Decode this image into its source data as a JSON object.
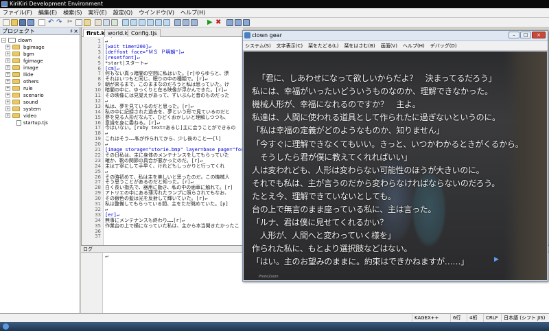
{
  "ide": {
    "title": "KiriKiri Development Environment",
    "menu": [
      "ファイル(F)",
      "編集(E)",
      "検索(S)",
      "実行(E)",
      "設定(Q)",
      "ウインドウ(V)",
      "ヘルプ(H)"
    ]
  },
  "project": {
    "header": "プロジェクト",
    "pin": "♯",
    "close": "×",
    "root": "clown",
    "folders": [
      "bgimage",
      "bgm",
      "fgimage",
      "image",
      "llide",
      "others",
      "rule",
      "scenario",
      "sound",
      "system",
      "video"
    ],
    "files": [
      "startup.tjs"
    ]
  },
  "editor": {
    "tabs": [
      "first.ks",
      "world.ks",
      "Config.tjs"
    ],
    "line_numbers": [
      "1",
      "2",
      "3",
      "4",
      "5",
      "6",
      "7",
      "8",
      "9",
      "10",
      "11",
      "12",
      "13",
      "14",
      "15",
      "16",
      "17",
      "18",
      "19",
      "20",
      "21",
      "22",
      "23",
      "24",
      "25",
      "26",
      "27",
      "28",
      "29",
      "30",
      "31",
      "32",
      "33",
      "34",
      "35",
      "36",
      "37"
    ],
    "lines": [
      {
        "t": "↵",
        "c": "c-dark"
      },
      {
        "t": "[wait time=200]↵",
        "c": "c-blue"
      },
      {
        "t": "[deffont face=\"ＭＳ Ｐ明朝\"]↵",
        "c": "c-blue"
      },
      {
        "t": "[resetfont]↵",
        "c": "c-blue"
      },
      {
        "t": "*start|スタート↵",
        "c": "c-dark"
      },
      {
        "t": "[cm]↵",
        "c": "c-blue"
      },
      {
        "t": "何もない真っ暗闇の空間に私はいた。[r]ゆらゆらと、漂",
        "c": "c-dark"
      },
      {
        "t": "それはいつもと同じ、眠りの中の種類で。[r]↵",
        "c": "c-dark"
      },
      {
        "t": "朝が来るまで、このままなのだろうと私は思っていた。け",
        "c": "c-dark"
      },
      {
        "t": "暗闇の中に、ゆっくりと在る映像が浮かんできた。[r]↵",
        "c": "c-dark"
      },
      {
        "t": "その映像には見覚えがあって、ずいぶんと昔のものだった",
        "c": "c-dark"
      },
      {
        "t": "↵",
        "c": "c-dark"
      },
      {
        "t": "私は、夢を見ているのだと思った。[r]↵",
        "c": "c-dark"
      },
      {
        "t": "私の中に記録された過去を、夢という形で見ているのだと",
        "c": "c-dark"
      },
      {
        "t": "夢を見る人形だなんて、ひどくおかしいと理解しつつも、",
        "c": "c-dark"
      },
      {
        "t": "意識を身に委ねる。[r]↵",
        "c": "c-dark"
      },
      {
        "t": "今はいない。[ruby text=あるじ]主に会うことができるの",
        "c": "c-dark"
      },
      {
        "t": "↵",
        "c": "c-dark"
      },
      {
        "t": "これはそう……私が作られてから、少し後のこと──[l]",
        "c": "c-dark"
      },
      {
        "t": "↵",
        "c": "c-dark"
      },
      {
        "t": "[image storage=\"storie.bmp\" layer=base page=\"fore\"]",
        "c": "c-blue"
      },
      {
        "t": "その日私は、主に身体のメンテナンスをしてもらっていた",
        "c": "c-dark"
      },
      {
        "t": "確か、靴の関節の具合が悪かったのだ。[r]↵",
        "c": "c-dark"
      },
      {
        "t": "主は丁寧にして手早く、けれどもしっかりと行ってくれ",
        "c": "c-dark"
      },
      {
        "t": "↵",
        "c": "c-dark"
      },
      {
        "t": "その時初めて、私は主を美しいと思ったのだ。この機械人",
        "c": "c-dark"
      },
      {
        "t": "そう思うことがあるのだと知った。[r]↵",
        "c": "c-dark"
      },
      {
        "t": "白く長い指先で、器用に動き、私の中の歯車に触れて。[r]",
        "c": "c-dark"
      },
      {
        "t": "アトリエの中にある薄汚れたランプに照らされてもなお、",
        "c": "c-dark"
      },
      {
        "t": "その銀色の髪は光を反射して輝いていた。[r]↵",
        "c": "c-dark"
      },
      {
        "t": "私は整備してもらっている間、主をただ眺めていた。[p]",
        "c": "c-dark"
      },
      {
        "t": "↵",
        "c": "c-dark"
      },
      {
        "t": "[er]↵",
        "c": "c-blue"
      },
      {
        "t": "無事にメンテナンスも終わり……[r]↵",
        "c": "c-dark"
      },
      {
        "t": "作業台の上で横になっていた私は、主から本当聞きたかったこ",
        "c": "c-dark"
      }
    ]
  },
  "log": {
    "label": "ログ",
    "content": "↵"
  },
  "status": {
    "mode": "KAGEX++",
    "col": "6行",
    "row": "4桁",
    "eol": "CRLF",
    "encoding": "日本語 (シフト JIS)"
  },
  "game": {
    "title": "clown gear",
    "menu": [
      "システム(S)",
      "文字表示(C)",
      "栞をたどる(L)",
      "栞をはさむ(B)",
      "画面(V)",
      "ヘルプ(H)",
      "デバッグ(D)"
    ],
    "lines": [
      "「君に、しあわせになって欲しいからだよ？　決まってるだろう」",
      "私には、幸福がいったいどういうものなのか、理解できなかった。",
      "機械人形が、幸福になれるのですか？　主よ。",
      "私達は、人間に使われる道具として作られたに過ぎないというのに。",
      "「私は幸福の定義がどのようなものか、知りません」",
      "「今すぐに理解できなくてもいい。きっと、いつかわかるときがくるから。",
      "　そうしたら君が僕に教えてくれればいい」",
      "人は変われども、人形は変わらない可能性のほうが大きいのに。",
      "それでも私は、主が言うのだから変わらなければならないのだろう。",
      "たとえ今、理解できていないとしても。",
      "台の上で無言のまま座っている私に、主は言った。",
      "「ルナ、君は僕に見せてくれるかい？",
      "　人形が、人間へと変わっていく様を」",
      "作られた私に、もとより選択肢などはない。",
      "「はい。主のお望みのままに。約束はできかねますが……」"
    ],
    "cursor": "▶",
    "footer": "PhotoZoom",
    "btn_min": "–",
    "btn_max": "□",
    "btn_close": "×"
  },
  "colors": {
    "accent": "#4a7cc0",
    "code_tag": "#0000d0",
    "game_text": "#f2f2f2"
  }
}
